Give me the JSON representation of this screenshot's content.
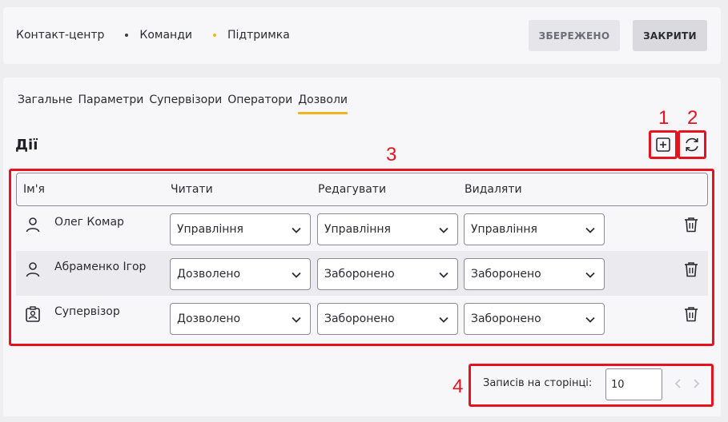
{
  "breadcrumbs": [
    {
      "label": "Контакт-центр",
      "dot_color": null
    },
    {
      "label": "Команди",
      "dot_color": "#3a3a48"
    },
    {
      "label": "Підтримка",
      "dot_color": "#f0b51c"
    }
  ],
  "header": {
    "saved_label": "ЗБЕРЕЖЕНО",
    "close_label": "ЗАКРИТИ"
  },
  "tabs": [
    {
      "label": "Загальне",
      "active": false
    },
    {
      "label": "Параметри",
      "active": false
    },
    {
      "label": "Супервізори",
      "active": false
    },
    {
      "label": "Оператори",
      "active": false
    },
    {
      "label": "Дозволи",
      "active": true
    }
  ],
  "section": {
    "title": "Дії",
    "add_icon": "plus-square-icon",
    "refresh_icon": "refresh-icon"
  },
  "table": {
    "columns": [
      "Ім'я",
      "Читати",
      "Редагувати",
      "Видаляти"
    ],
    "rows": [
      {
        "icon": "user-icon",
        "name": "Олег Комар",
        "read": "Управління",
        "edit": "Управління",
        "delete": "Управління"
      },
      {
        "icon": "user-icon",
        "name": "Абраменко Ігор",
        "read": "Дозволено",
        "edit": "Заборонено",
        "delete": "Заборонено"
      },
      {
        "icon": "supervisor-badge-icon",
        "name": "Супервізор",
        "read": "Дозволено",
        "edit": "Заборонено",
        "delete": "Заборонено"
      }
    ]
  },
  "pager": {
    "label": "Записів на сторінці:",
    "per_page": "10"
  },
  "annotations": {
    "markers": [
      "1",
      "2",
      "3",
      "4"
    ],
    "color": "#e6131f"
  },
  "colors": {
    "accent": "#f0b51c",
    "annotation": "#e6131f"
  }
}
